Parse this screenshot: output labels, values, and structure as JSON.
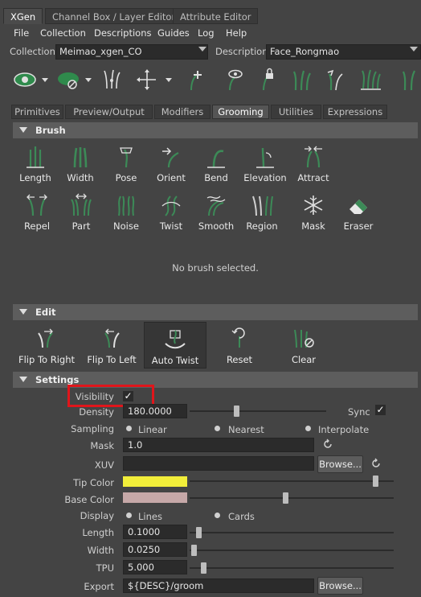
{
  "top_tabs": [
    "XGen",
    "Channel Box / Layer Editor",
    "Attribute Editor"
  ],
  "menu": [
    "File",
    "Collection",
    "Descriptions",
    "Guides",
    "Log",
    "Help"
  ],
  "collection": {
    "label": "Collection",
    "value": "Meimao_xgen_CO"
  },
  "description": {
    "label": "Description",
    "value": "Face_Rongmao"
  },
  "section_tabs": [
    "Primitives",
    "Preview/Output",
    "Modifiers",
    "Grooming",
    "Utilities",
    "Expressions"
  ],
  "brush": {
    "header": "Brush",
    "items": [
      "Length",
      "Width",
      "Pose",
      "Orient",
      "Bend",
      "Elevation",
      "Attract",
      "Repel",
      "Part",
      "Noise",
      "Twist",
      "Smooth",
      "Region",
      "Mask",
      "Eraser"
    ],
    "status": "No brush selected."
  },
  "edit": {
    "header": "Edit",
    "items": [
      "Flip To Right",
      "Flip To Left",
      "Auto Twist",
      "Reset",
      "Clear"
    ]
  },
  "settings": {
    "header": "Settings",
    "visibility_label": "Visibility",
    "density_label": "Density",
    "density_value": "180.0000",
    "sync_label": "Sync",
    "sampling_label": "Sampling",
    "sampling_options": [
      "Linear",
      "Nearest",
      "Interpolate"
    ],
    "mask_label": "Mask",
    "mask_value": "1.0",
    "xuv_label": "XUV",
    "xuv_value": "",
    "browse_label": "Browse...",
    "tip_color_label": "Tip Color",
    "base_color_label": "Base Color",
    "display_label": "Display",
    "display_options": [
      "Lines",
      "Cards"
    ],
    "length_label": "Length",
    "length_value": "0.1000",
    "width_label": "Width",
    "width_value": "0.0250",
    "tpu_label": "TPU",
    "tpu_value": "5.000",
    "export_label": "Export",
    "export_value": "${DESC}/groom"
  },
  "colors": {
    "tip_color": "#f2ee3a",
    "base_color": "#c6a8a8",
    "highlight_box": "#e0151b",
    "grass_green": "#3c8a57"
  }
}
